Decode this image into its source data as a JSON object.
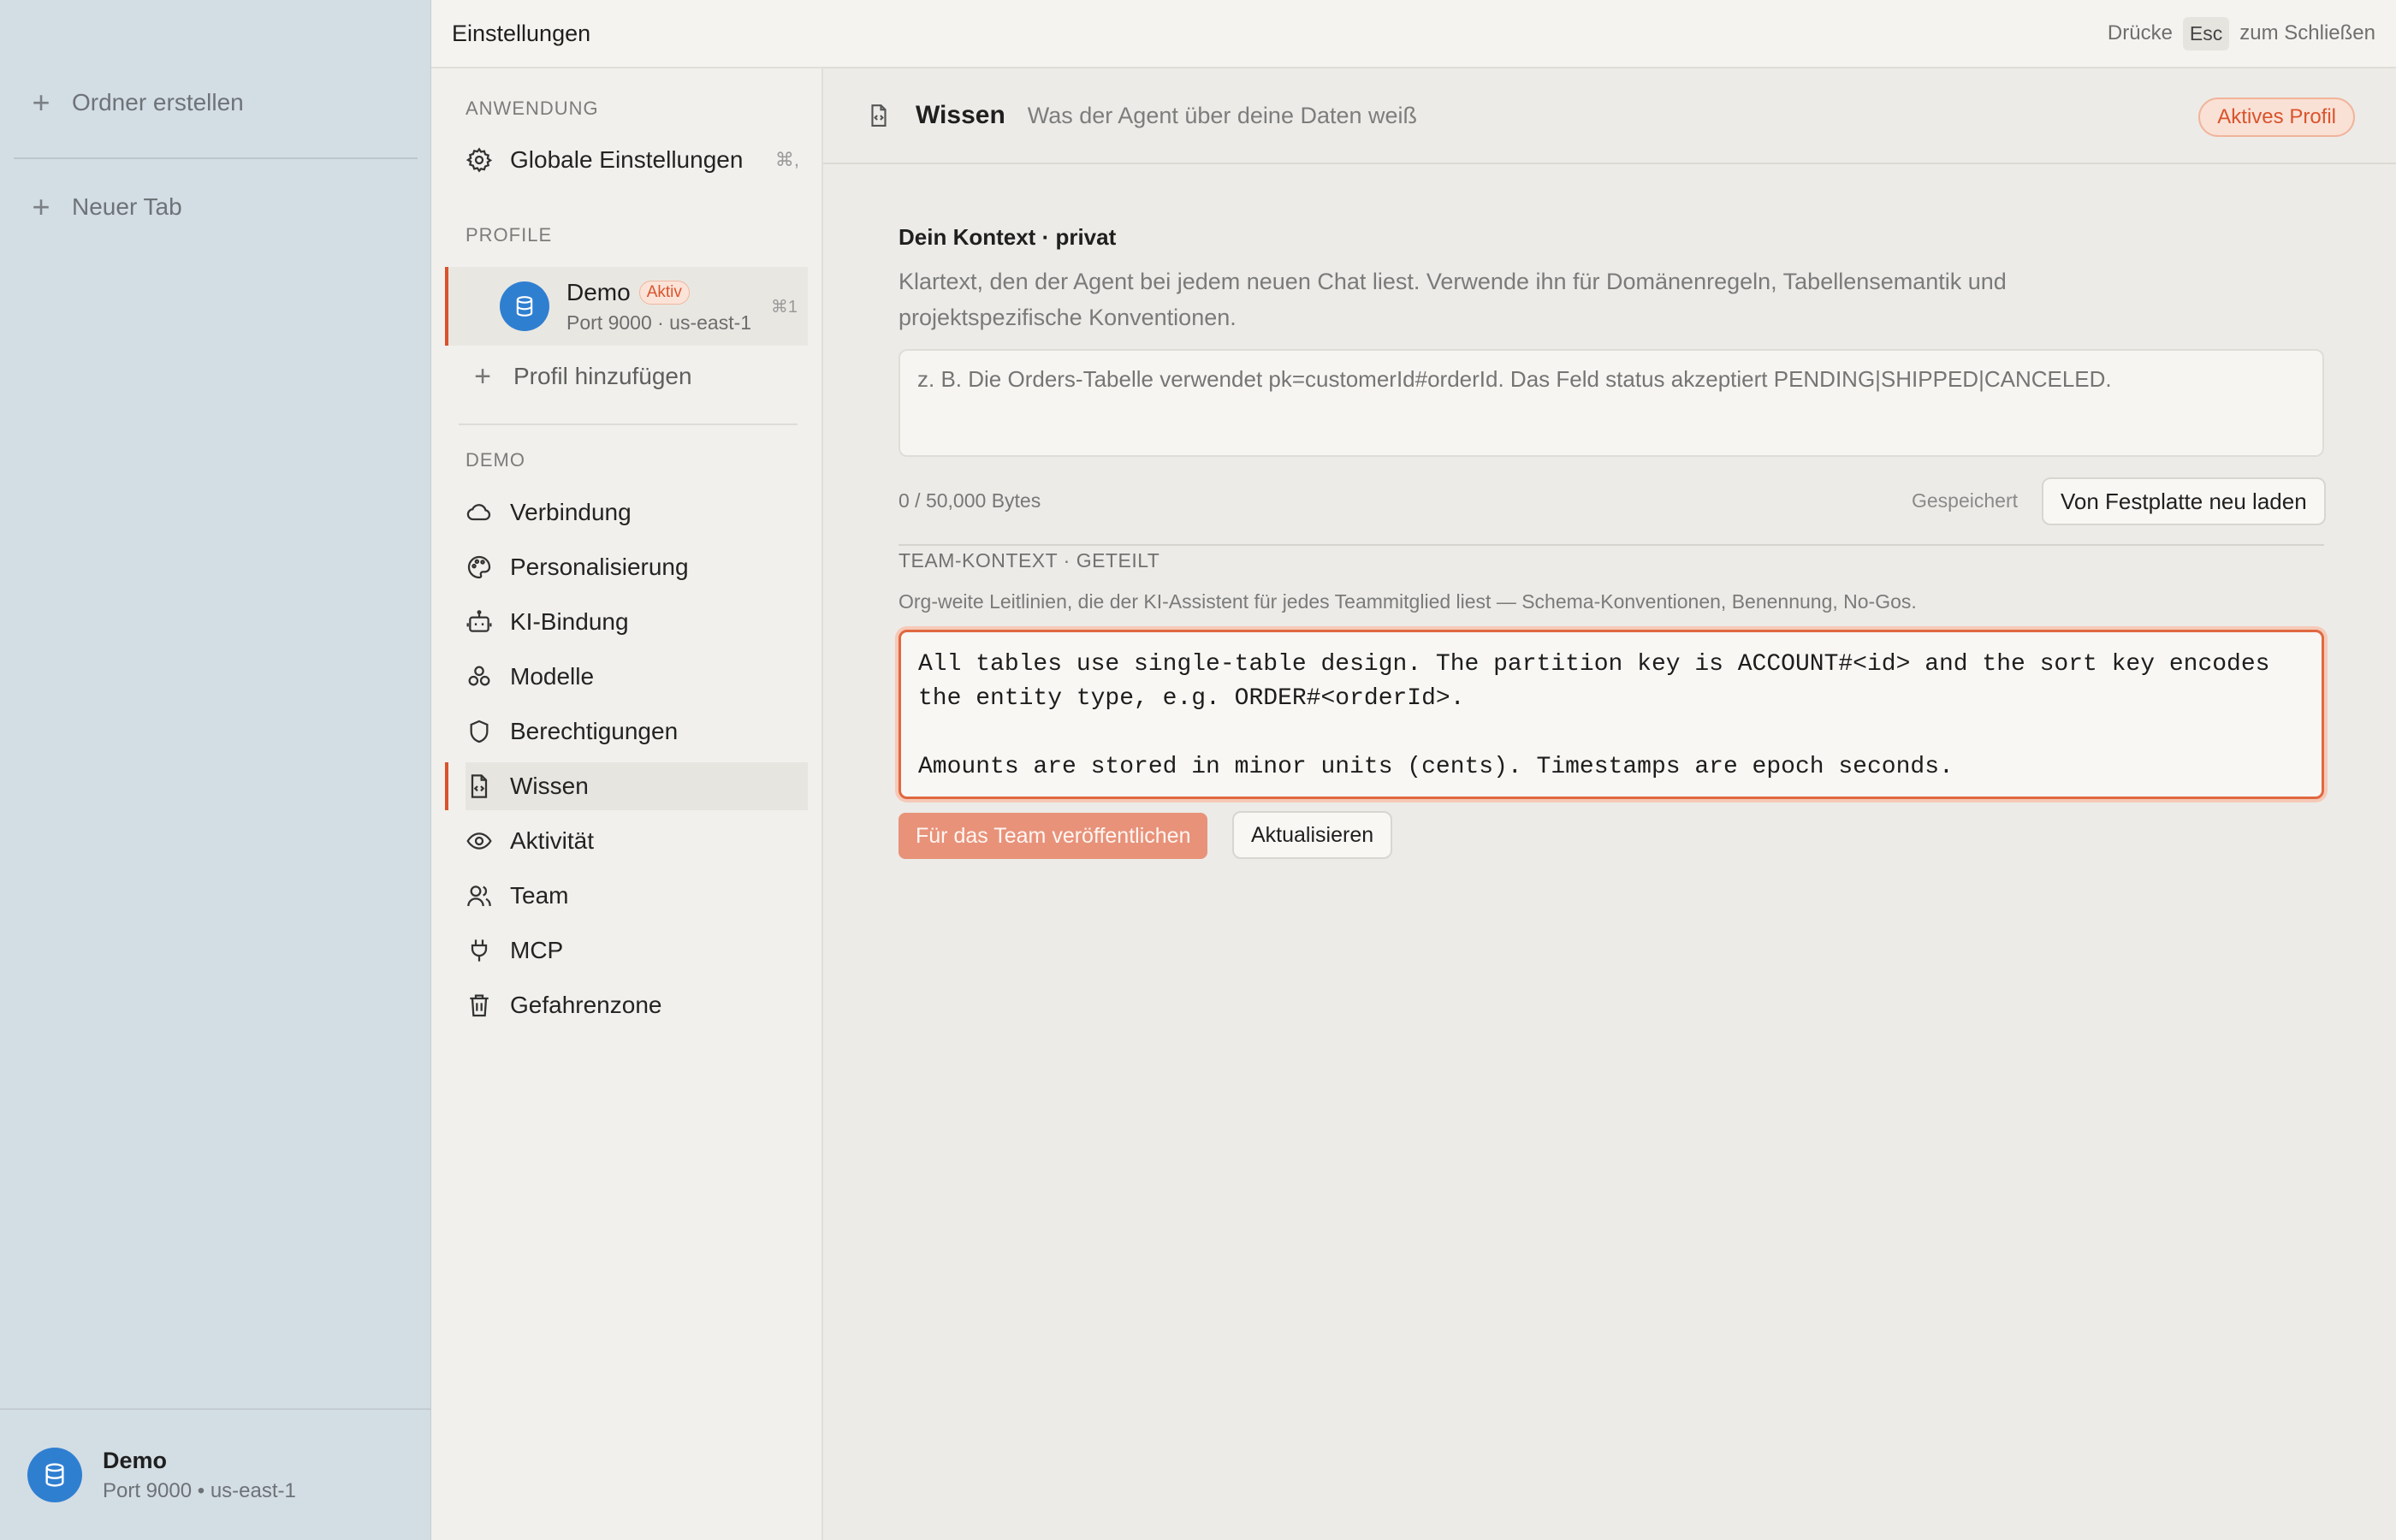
{
  "app_sidebar": {
    "actions": [
      {
        "label": "Ordner erstellen",
        "icon": "plus-icon"
      },
      {
        "label": "Neuer Tab",
        "icon": "plus-icon"
      }
    ],
    "footer": {
      "name": "Demo",
      "sub": "Port 9000 • us-east-1",
      "icon": "database-icon"
    }
  },
  "header": {
    "title": "Einstellungen",
    "hint_prefix": "Drücke",
    "hint_key": "Esc",
    "hint_suffix": "zum Schließen"
  },
  "nav": {
    "sections": {
      "application": "ANWENDUNG",
      "profiles": "PROFILE",
      "demo": "DEMO"
    },
    "global_settings": {
      "label": "Globale Einstellungen",
      "shortcut": "⌘,",
      "icon": "gear-icon"
    },
    "profile": {
      "name": "Demo",
      "badge": "Aktiv",
      "sub": "Port 9000 · us-east-1",
      "shortcut": "⌘1",
      "icon": "database-icon"
    },
    "add_profile": {
      "label": "Profil hinzufügen",
      "icon": "plus-icon"
    },
    "items": [
      {
        "label": "Verbindung",
        "icon": "cloud-icon"
      },
      {
        "label": "Personalisierung",
        "icon": "palette-icon"
      },
      {
        "label": "KI-Bindung",
        "icon": "robot-icon"
      },
      {
        "label": "Modelle",
        "icon": "models-icon"
      },
      {
        "label": "Berechtigungen",
        "icon": "shield-icon"
      },
      {
        "label": "Wissen",
        "icon": "document-code-icon",
        "active": true
      },
      {
        "label": "Aktivität",
        "icon": "eye-icon"
      },
      {
        "label": "Team",
        "icon": "users-icon"
      },
      {
        "label": "MCP",
        "icon": "plug-icon"
      },
      {
        "label": "Gefahrenzone",
        "icon": "trash-icon"
      }
    ]
  },
  "content": {
    "title": "Wissen",
    "subtitle": "Was der Agent über deine Daten weiß",
    "badge": "Aktives Profil",
    "private": {
      "title": "Dein Kontext · privat",
      "description": "Klartext, den der Agent bei jedem neuen Chat liest. Verwende ihn für Domänenregeln, Tabellensemantik und projektspezifische Konventionen.",
      "placeholder": "z. B. Die Orders-Tabelle verwendet pk=customerId#orderId. Das Feld status akzeptiert PENDING|SHIPPED|CANCELED.",
      "value": "",
      "byte_count": "0 / 50,000 Bytes",
      "saved_label": "Gespeichert",
      "reload_button": "Von Festplatte neu laden"
    },
    "team": {
      "title": "TEAM-KONTEXT · GETEILT",
      "description": "Org-weite Leitlinien, die der KI-Assistent für jedes Teammitglied liest — Schema-Konventionen, Benennung, No-Gos.",
      "value": "All tables use single-table design. The partition key is ACCOUNT#<id> and the sort key encodes\nthe entity type, e.g. ORDER#<orderId>.\n\nAmounts are stored in minor units (cents). Timestamps are epoch seconds.",
      "publish_button": "Für das Team veröffentlichen",
      "update_button": "Aktualisieren"
    }
  },
  "colors": {
    "accent": "#d9542c",
    "avatar": "#2f7fd1",
    "publish_button": "#e8927a"
  }
}
